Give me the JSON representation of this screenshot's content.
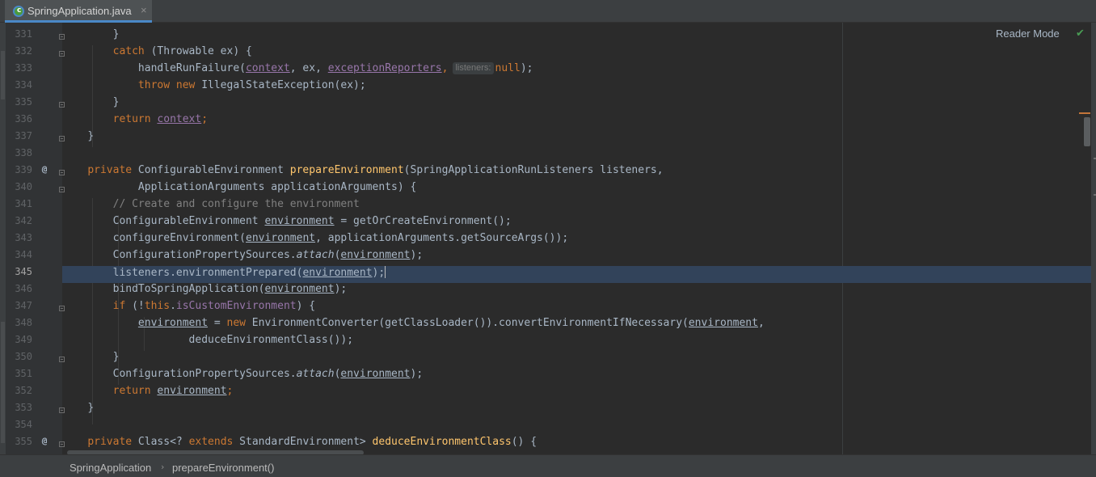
{
  "tab": {
    "title": "SpringApplication.java",
    "close": "×",
    "icon": "spring-java-class-icon"
  },
  "reader_mode": {
    "label": "Reader Mode",
    "icon": "check-icon"
  },
  "breadcrumb": {
    "items": [
      "SpringApplication",
      "prepareEnvironment()"
    ],
    "separator": "›"
  },
  "current_line": 345,
  "gutter_icons": {
    "override_icon": "@"
  },
  "inlay_hint": "listeners:",
  "line_numbers": [
    "331",
    "332",
    "333",
    "334",
    "335",
    "336",
    "337",
    "338",
    "339",
    "340",
    "341",
    "342",
    "343",
    "344",
    "345",
    "346",
    "347",
    "348",
    "349",
    "350",
    "351",
    "352",
    "353",
    "354",
    "355"
  ],
  "code": {
    "l331": [
      "}"
    ],
    "l332": [
      "catch",
      " (Throwable ex) {"
    ],
    "l333": [
      "handleRunFailure(",
      "context",
      ", ex, ",
      "exceptionReporters",
      ",",
      "null",
      ");"
    ],
    "l334": [
      "throw",
      " ",
      "new",
      " IllegalStateException(ex);"
    ],
    "l335": [
      "}"
    ],
    "l336": [
      "return",
      " ",
      "context",
      ";"
    ],
    "l337": [
      "}"
    ],
    "l339": [
      "private",
      " ConfigurableEnvironment ",
      "prepareEnvironment",
      "(SpringApplicationRunListeners listeners,"
    ],
    "l340": [
      "ApplicationArguments applicationArguments) {"
    ],
    "l341": [
      "// Create and configure the environment"
    ],
    "l342": [
      "ConfigurableEnvironment ",
      "environment",
      " = getOrCreateEnvironment();"
    ],
    "l343": [
      "configureEnvironment(",
      "environment",
      ", applicationArguments.getSourceArgs());"
    ],
    "l344": [
      "ConfigurationPropertySources.",
      "attach",
      "(",
      "environment",
      ");"
    ],
    "l345": [
      "listeners.environmentPrepared(",
      "environment",
      ");"
    ],
    "l346": [
      "bindToSpringApplication(",
      "environment",
      ");"
    ],
    "l347": [
      "if",
      " (!",
      "this",
      ".",
      "isCustomEnvironment",
      ") {"
    ],
    "l348": [
      "environment",
      " = ",
      "new",
      " EnvironmentConverter(getClassLoader()).convertEnvironmentIfNecessary(",
      "environment",
      ","
    ],
    "l349": [
      "deduceEnvironmentClass());"
    ],
    "l350": [
      "}"
    ],
    "l351": [
      "ConfigurationPropertySources.",
      "attach",
      "(",
      "environment",
      ");"
    ],
    "l352": [
      "return",
      " ",
      "environment",
      ";"
    ],
    "l353": [
      "}"
    ],
    "l355": [
      "private",
      " Class<? ",
      "extends",
      " StandardEnvironment> ",
      "deduceEnvironmentClass",
      "() {"
    ]
  }
}
